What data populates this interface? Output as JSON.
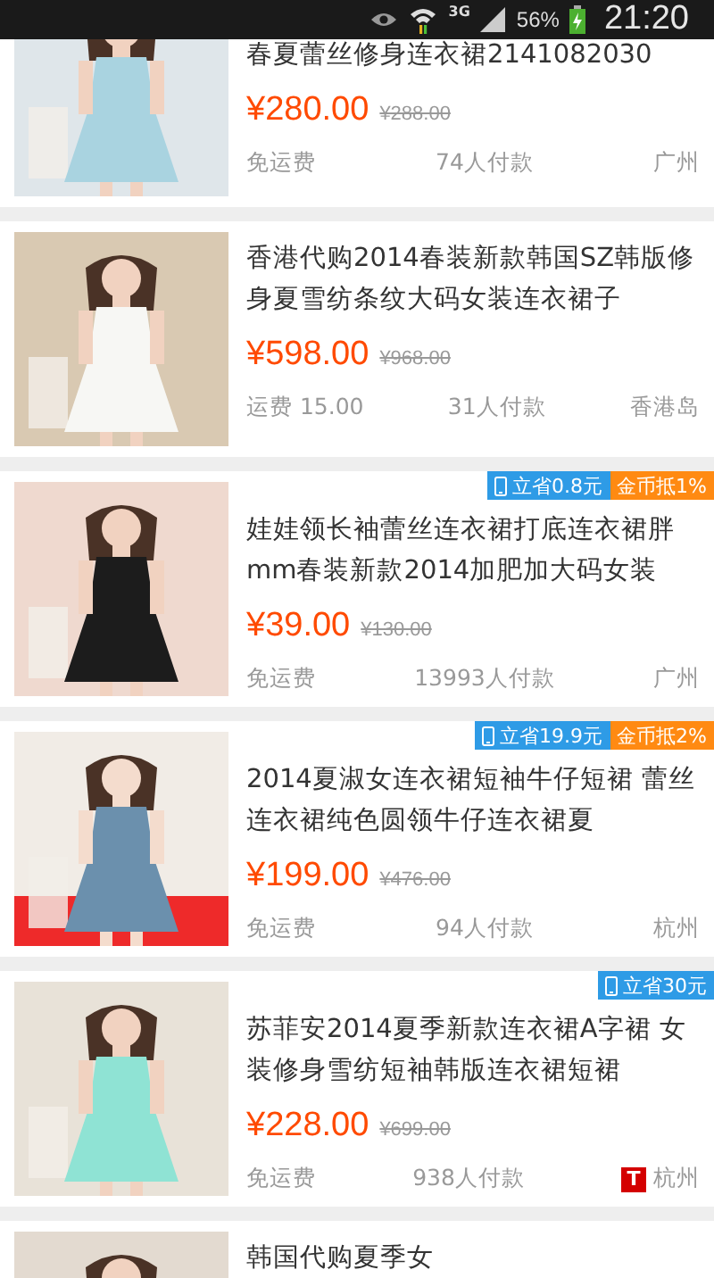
{
  "status_bar": {
    "network": "3G",
    "battery": "56%",
    "time": "21:20"
  },
  "products": [
    {
      "title": "春夏蕾丝修身连衣裙2141082030",
      "price": "¥280.00",
      "original_price": "¥288.00",
      "shipping": "免运费",
      "sold": "74人付款",
      "location": "广州"
    },
    {
      "title": "香港代购2014春装新款韩国SZ韩版修身夏雪纺条纹大码女装连衣裙子",
      "price": "¥598.00",
      "original_price": "¥968.00",
      "shipping": "运费 15.00",
      "sold": "31人付款",
      "location": "香港岛"
    },
    {
      "title": "娃娃领长袖蕾丝连衣裙打底连衣裙胖mm春装新款2014加肥加大码女装",
      "price": "¥39.00",
      "original_price": "¥130.00",
      "shipping": "免运费",
      "sold": "13993人付款",
      "location": "广州",
      "badges": [
        {
          "kind": "mobile",
          "text": "立省0.8元"
        },
        {
          "kind": "coins",
          "text": "金币抵1%"
        }
      ]
    },
    {
      "title": "2014夏淑女连衣裙短袖牛仔短裙 蕾丝连衣裙纯色圆领牛仔连衣裙夏",
      "price": "¥199.00",
      "original_price": "¥476.00",
      "shipping": "免运费",
      "sold": "94人付款",
      "location": "杭州",
      "badges": [
        {
          "kind": "mobile",
          "text": "立省19.9元"
        },
        {
          "kind": "coins",
          "text": "金币抵2%"
        }
      ]
    },
    {
      "title": "苏菲安2014夏季新款连衣裙A字裙 女装修身雪纺短袖韩版连衣裙短裙",
      "price": "¥228.00",
      "original_price": "¥699.00",
      "shipping": "免运费",
      "sold": "938人付款",
      "location": "杭州",
      "store_badge": "T",
      "badges": [
        {
          "kind": "mobile",
          "text": "立省30元"
        }
      ]
    },
    {
      "title": "韩国代购夏季女"
    }
  ]
}
